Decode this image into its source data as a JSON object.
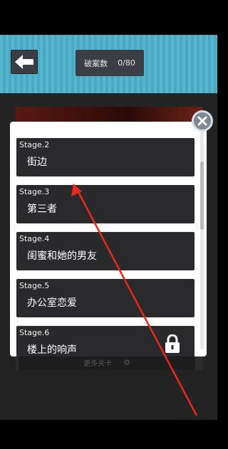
{
  "header": {
    "back_icon": "arrow-left-icon",
    "case_label": "破案数",
    "case_count": "0/80"
  },
  "stages": [
    {
      "stage": "Stage.2",
      "title": "街边",
      "locked": false
    },
    {
      "stage": "Stage.3",
      "title": "第三者",
      "locked": false
    },
    {
      "stage": "Stage.4",
      "title": "闺蜜和她的男友",
      "locked": false
    },
    {
      "stage": "Stage.5",
      "title": "办公室恋爱",
      "locked": false
    },
    {
      "stage": "Stage.6",
      "title": "楼上的响声",
      "locked": true
    }
  ],
  "footer": {
    "more_label": "更多关卡"
  },
  "colors": {
    "header_bg": "#57b6cf",
    "item_bg": "#2a2a2c",
    "annotation_arrow": "#e8281e"
  }
}
